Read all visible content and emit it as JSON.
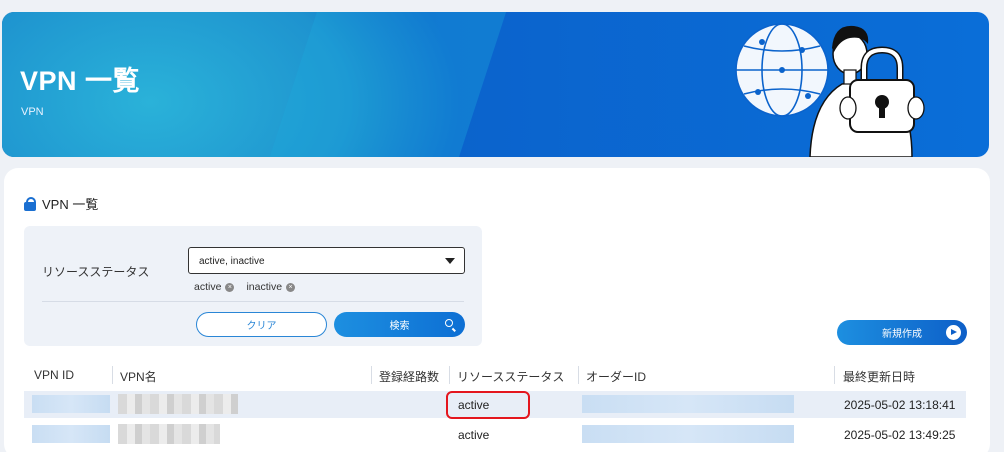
{
  "hero": {
    "title": "VPN 一覧",
    "subtitle": "VPN"
  },
  "section": {
    "title": "VPN 一覧"
  },
  "filter": {
    "label": "リソースステータス",
    "select_value": "active, inactive",
    "chips": [
      "active",
      "inactive"
    ],
    "clear_label": "クリア",
    "search_label": "検索"
  },
  "actions": {
    "new_label": "新規作成"
  },
  "table": {
    "headers": [
      "VPN ID",
      "VPN名",
      "登録経路数",
      "リソースステータス",
      "オーダーID",
      "最終更新日時"
    ],
    "rows": [
      {
        "status": "active",
        "updated": "2025-05-02 13:18:41"
      },
      {
        "status": "active",
        "updated": "2025-05-02 13:49:25"
      }
    ]
  },
  "colors": {
    "accent": "#1a6fd1",
    "highlight": "#e4161e",
    "hero": "#0b63cc"
  }
}
